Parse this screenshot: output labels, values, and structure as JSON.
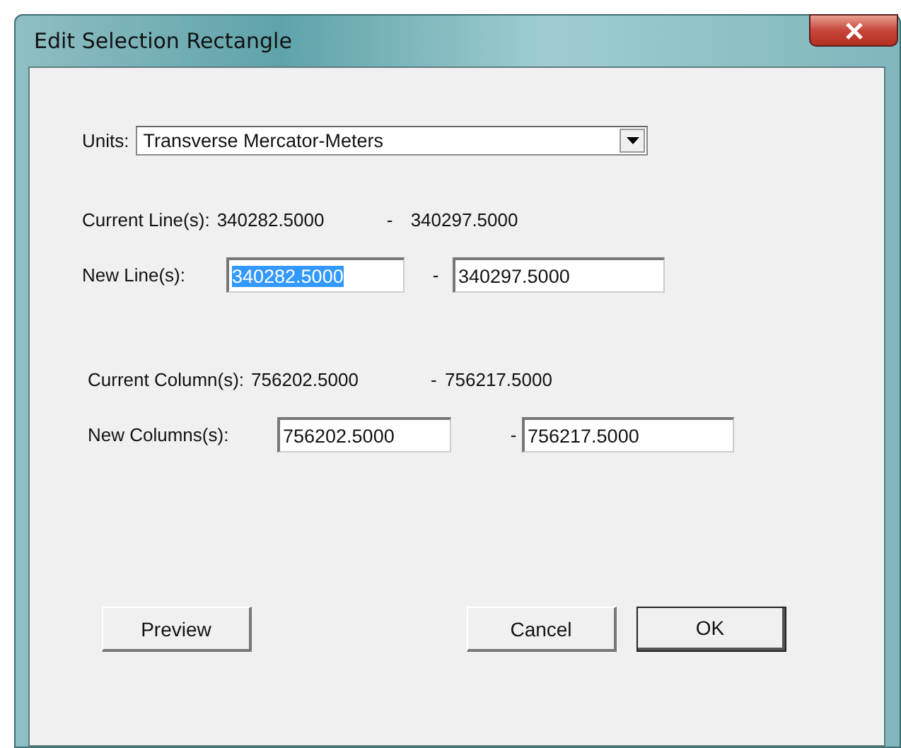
{
  "window": {
    "title": "Edit Selection Rectangle"
  },
  "units": {
    "label": "Units:",
    "value": "Transverse Mercator-Meters"
  },
  "lines": {
    "current_label": "Current Line(s):",
    "current_from": "340282.5000",
    "current_separator": "-",
    "current_to": "340297.5000",
    "new_label": "New Line(s):",
    "new_from": {
      "value": "340282.5000",
      "selected": true
    },
    "new_separator": "-",
    "new_to": {
      "value": "340297.5000",
      "selected": false
    }
  },
  "columns": {
    "current_label": "Current Column(s):",
    "current_from": "756202.5000",
    "current_separator": "-",
    "current_to": "756217.5000",
    "new_label": "New Columns(s):",
    "new_from": {
      "value": "756202.5000",
      "selected": false
    },
    "new_separator": "-",
    "new_to": {
      "value": "756217.5000",
      "selected": false
    }
  },
  "buttons": [
    {
      "label": "Preview",
      "default": false
    },
    {
      "label": "Cancel",
      "default": false
    },
    {
      "label": "OK",
      "default": true
    }
  ]
}
